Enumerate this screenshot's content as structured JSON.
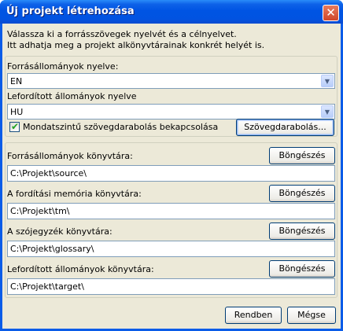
{
  "window": {
    "title": "Új projekt létrehozása",
    "close_symbol": "✕"
  },
  "intro": {
    "line1": "Válassza ki a forrásszövegek nyelvét és a célnyelvet.",
    "line2": "Itt adhatja meg a projekt alkönyvtárainak konkrét helyét is."
  },
  "languages": {
    "source_label": "Forrásállományok nyelve:",
    "source_value": "EN",
    "target_label": "Lefordított állományok nyelve",
    "target_value": "HU",
    "arrow_symbol": "▼"
  },
  "segmentation": {
    "checkbox_label": "Mondatszintű szövegdarabolás bekapcsolása",
    "checked": true,
    "check_symbol": "✔",
    "button_label": "Szövegdarabolás..."
  },
  "folders": {
    "browse_label": "Böngészés",
    "source_label": "Forrásállományok könyvtára:",
    "source_value": "C:\\Projekt\\source\\",
    "tm_label": "A fordítási memória könyvtára:",
    "tm_value": "C:\\Projekt\\tm\\",
    "glossary_label": "A szójegyzék könyvtára:",
    "glossary_value": "C:\\Projekt\\glossary\\",
    "target_label": "Lefordított állományok könyvtára:",
    "target_value": "C:\\Projekt\\target\\"
  },
  "actions": {
    "ok_label": "Rendben",
    "cancel_label": "Mégse"
  }
}
